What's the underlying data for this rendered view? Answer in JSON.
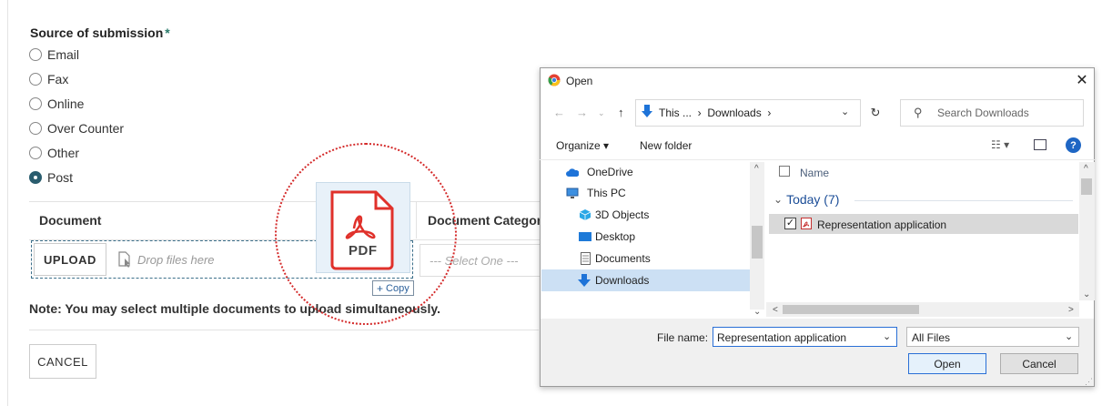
{
  "form": {
    "title": "Source of submission",
    "required_mark": "*",
    "options": [
      {
        "label": "Email",
        "checked": false
      },
      {
        "label": "Fax",
        "checked": false
      },
      {
        "label": "Online",
        "checked": false
      },
      {
        "label": "Over Counter",
        "checked": false
      },
      {
        "label": "Other",
        "checked": false
      },
      {
        "label": "Post",
        "checked": true
      }
    ],
    "table": {
      "col_document": "Document",
      "col_category": "Document Categor",
      "upload_label": "UPLOAD",
      "drop_placeholder": "Drop files here",
      "select_placeholder": "--- Select One ---"
    },
    "note": "Note: You may select multiple documents to upload simultaneously.",
    "cancel_label": "CANCEL"
  },
  "drag": {
    "tile_label": "PDF",
    "copy_label": "Copy"
  },
  "dialog": {
    "title": "Open",
    "close_glyph": "✕",
    "address": "This ...  ›  Downloads  ›",
    "search_placeholder": "Search Downloads",
    "toolbar": {
      "organize": "Organize ▾",
      "new_folder": "New folder"
    },
    "nav_items": [
      {
        "label": "OneDrive",
        "icon": "cloud-icon"
      },
      {
        "label": "This PC",
        "icon": "computer-icon"
      },
      {
        "label": "3D Objects",
        "icon": "cube-icon"
      },
      {
        "label": "Desktop",
        "icon": "desktop-icon"
      },
      {
        "label": "Documents",
        "icon": "document-icon"
      },
      {
        "label": "Downloads",
        "icon": "download-icon",
        "selected": true
      }
    ],
    "list_header": "Name",
    "group_label": "Today (7)",
    "files": [
      {
        "name": "Representation application",
        "checked": true,
        "icon": "pdf-icon"
      }
    ],
    "file_name_label": "File name:",
    "file_name_value": "Representation application",
    "file_type_value": "All Files",
    "open_label": "Open",
    "cancel_label": "Cancel"
  },
  "colors": {
    "accent": "#2a5d6e",
    "drag_circle": "#d42a2a",
    "pdf_red": "#e0312b",
    "dialog_link": "#1b4d97"
  }
}
